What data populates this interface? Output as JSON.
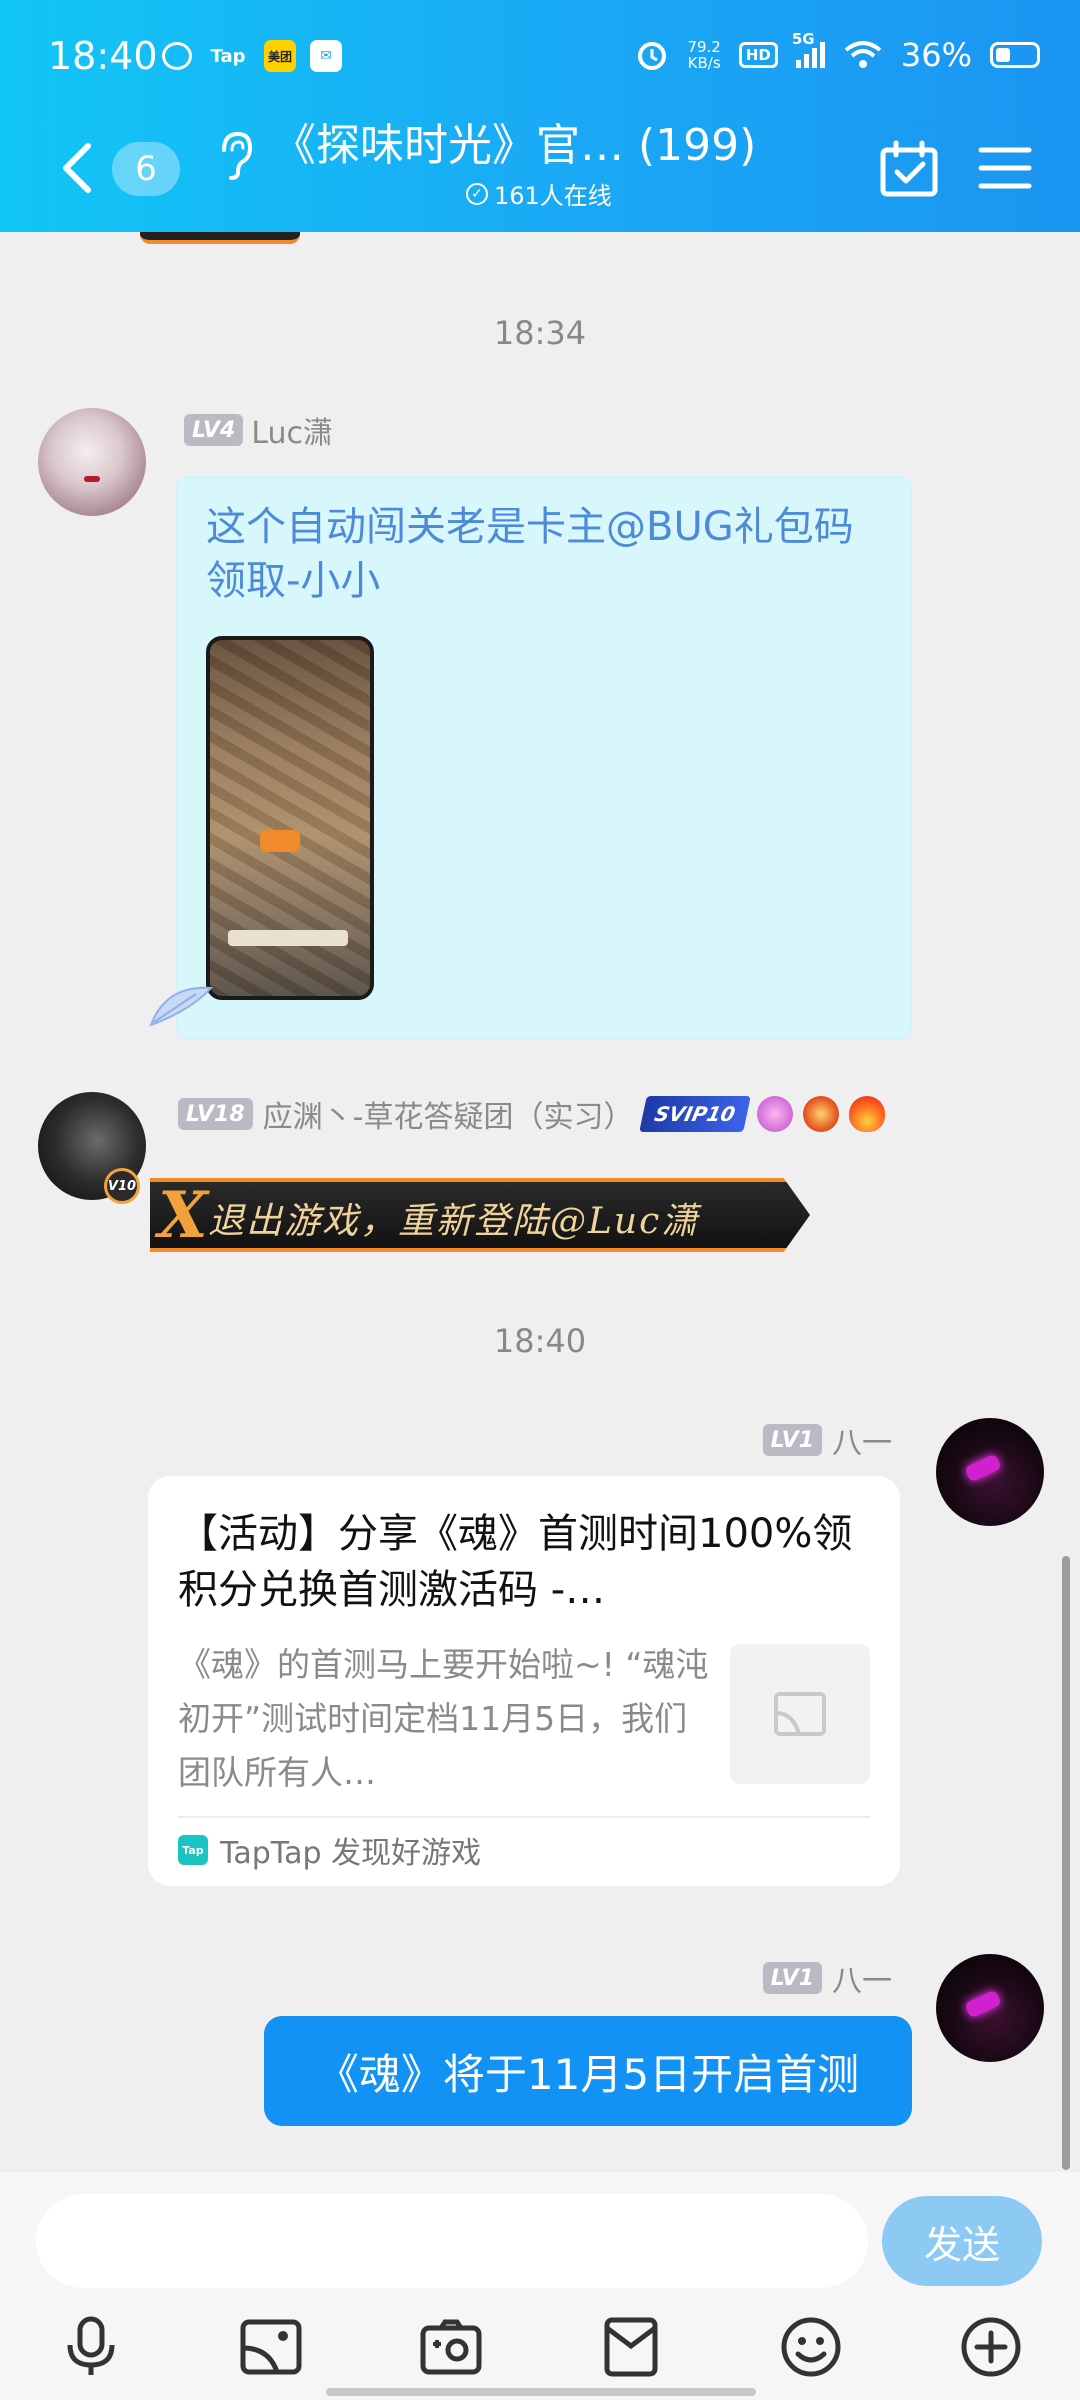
{
  "status_bar": {
    "time": "18:40",
    "apps": [
      "wechat-icon",
      "Tap",
      "美团",
      "message-icon"
    ],
    "meituan_label": "美团",
    "tap_label": "Tap",
    "net_speed_top": "79.2",
    "net_speed_bottom": "KB/s",
    "hd_label": "HD",
    "network": "5G",
    "battery": "36%"
  },
  "header": {
    "unread_count": "6",
    "title": "《探味时光》官… (199)",
    "online": "161人在线"
  },
  "messages": {
    "time1": "18:34",
    "luc": {
      "level": "LV4",
      "name": "Luc潇",
      "text": "这个自动闯关老是卡主@BUG礼包码领取-小小"
    },
    "ying": {
      "level": "LV18",
      "name": "应渊丶-草花答疑团（实习）",
      "badge": "SVIP10",
      "vip_badge": "V10",
      "text": "退出游戏，重新登陆@Luc潇",
      "x_mark": "X"
    },
    "time2": "18:40",
    "bayi_card": {
      "level": "LV1",
      "name": "八一",
      "title": "【活动】分享《魂》首测时间100%领积分兑换首测激活码 -…",
      "desc": "《魂》的首测马上要开始啦~! “魂沌初开”测试时间定档11月5日，我们团队所有人…",
      "source": "TapTap 发现好游戏",
      "source_logo": "Tap"
    },
    "bayi_text": {
      "level": "LV1",
      "name": "八一",
      "text": "《魂》将于11月5日开启首测"
    }
  },
  "input": {
    "placeholder": "",
    "send_label": "发送"
  },
  "toolbar": [
    "microphone-icon",
    "image-icon",
    "camera-icon",
    "red-packet-icon",
    "emoji-icon",
    "plus-icon"
  ],
  "colors": {
    "header_start": "#12c6f5",
    "header_end": "#1b95f2",
    "bubble_blue": "#1292f5",
    "luc_bubble": "#d7f7fb",
    "luc_text": "#4d8ad9",
    "send_button": "#8ccaf4"
  }
}
